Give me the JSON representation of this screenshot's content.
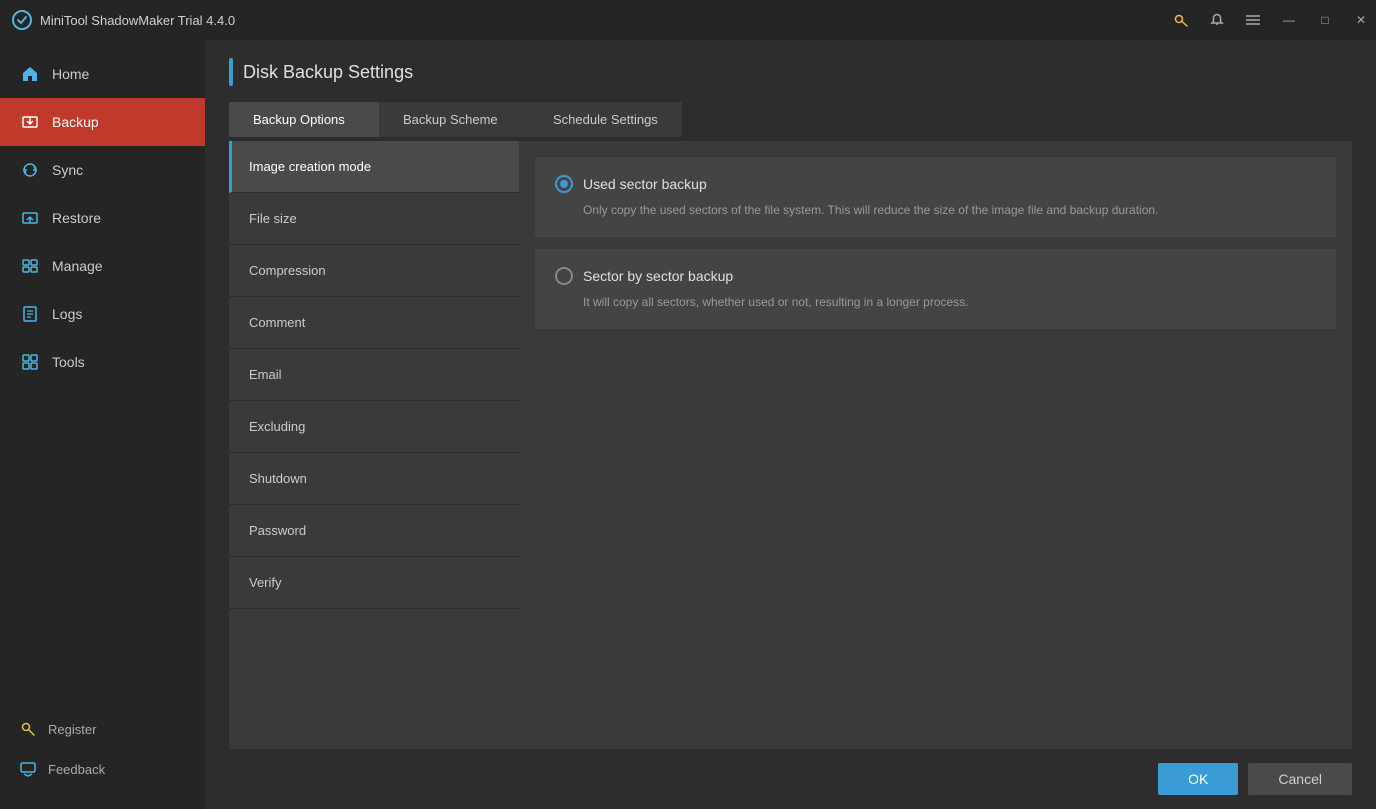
{
  "app": {
    "title": "MiniTool ShadowMaker Trial 4.4.0"
  },
  "titlebar": {
    "controls": {
      "minimize": "—",
      "maximize": "□",
      "close": "✕"
    }
  },
  "sidebar": {
    "items": [
      {
        "id": "home",
        "label": "Home",
        "active": false
      },
      {
        "id": "backup",
        "label": "Backup",
        "active": true
      },
      {
        "id": "sync",
        "label": "Sync",
        "active": false
      },
      {
        "id": "restore",
        "label": "Restore",
        "active": false
      },
      {
        "id": "manage",
        "label": "Manage",
        "active": false
      },
      {
        "id": "logs",
        "label": "Logs",
        "active": false
      },
      {
        "id": "tools",
        "label": "Tools",
        "active": false
      }
    ],
    "bottom": [
      {
        "id": "register",
        "label": "Register"
      },
      {
        "id": "feedback",
        "label": "Feedback"
      }
    ]
  },
  "page": {
    "title": "Disk Backup Settings"
  },
  "tabs": [
    {
      "id": "backup-options",
      "label": "Backup Options",
      "active": true
    },
    {
      "id": "backup-scheme",
      "label": "Backup Scheme",
      "active": false
    },
    {
      "id": "schedule-settings",
      "label": "Schedule Settings",
      "active": false
    }
  ],
  "options_list": [
    {
      "id": "image-creation-mode",
      "label": "Image creation mode",
      "selected": true
    },
    {
      "id": "file-size",
      "label": "File size",
      "selected": false
    },
    {
      "id": "compression",
      "label": "Compression",
      "selected": false
    },
    {
      "id": "comment",
      "label": "Comment",
      "selected": false
    },
    {
      "id": "email",
      "label": "Email",
      "selected": false
    },
    {
      "id": "excluding",
      "label": "Excluding",
      "selected": false
    },
    {
      "id": "shutdown",
      "label": "Shutdown",
      "selected": false
    },
    {
      "id": "password",
      "label": "Password",
      "selected": false
    },
    {
      "id": "verify",
      "label": "Verify",
      "selected": false
    }
  ],
  "content": {
    "radio_options": [
      {
        "id": "used-sector",
        "label": "Used sector backup",
        "desc": "Only copy the used sectors of the file system. This will reduce the size of the image file and backup duration.",
        "checked": true
      },
      {
        "id": "sector-by-sector",
        "label": "Sector by sector backup",
        "desc": "It will copy all sectors, whether used or not, resulting in a longer process.",
        "checked": false
      }
    ]
  },
  "footer": {
    "ok_label": "OK",
    "cancel_label": "Cancel"
  }
}
